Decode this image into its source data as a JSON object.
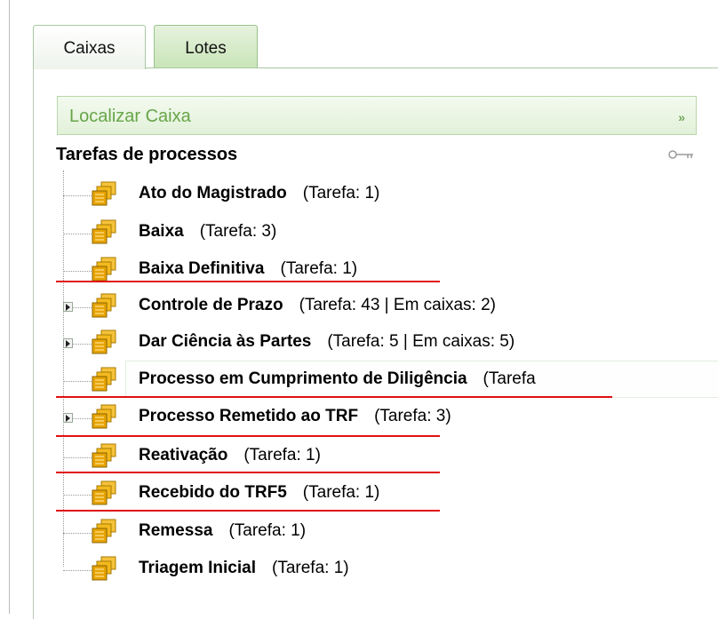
{
  "tabs": [
    {
      "label": "Caixas",
      "active": true
    },
    {
      "label": "Lotes",
      "active": false
    }
  ],
  "search": {
    "label": "Localizar Caixa",
    "arrow": "»"
  },
  "tree": {
    "title": "Tarefas de processos",
    "items": [
      {
        "name": "Ato do Magistrado",
        "count": "(Tarefa: 1)",
        "expandable": false,
        "selected": false
      },
      {
        "name": "Baixa",
        "count": "(Tarefa: 3)",
        "expandable": false,
        "selected": false
      },
      {
        "name": "Baixa Definitiva",
        "count": "(Tarefa: 1)",
        "expandable": false,
        "selected": false
      },
      {
        "name": "Controle de Prazo",
        "count": "(Tarefa: 43 | Em caixas: 2)",
        "expandable": true,
        "selected": false
      },
      {
        "name": "Dar Ciência às Partes",
        "count": "(Tarefa: 5 | Em caixas: 5)",
        "expandable": true,
        "selected": false
      },
      {
        "name": "Processo em Cumprimento de Diligência",
        "count": "(Tarefa",
        "expandable": false,
        "selected": true
      },
      {
        "name": "Processo Remetido ao TRF",
        "count": "(Tarefa: 3)",
        "expandable": true,
        "selected": false
      },
      {
        "name": "Reativação",
        "count": "(Tarefa: 1)",
        "expandable": false,
        "selected": false
      },
      {
        "name": "Recebido do TRF5",
        "count": "(Tarefa: 1)",
        "expandable": false,
        "selected": false
      },
      {
        "name": "Remessa",
        "count": "(Tarefa: 1)",
        "expandable": false,
        "selected": false
      },
      {
        "name": "Triagem Inicial",
        "count": "(Tarefa: 1)",
        "expandable": false,
        "selected": false
      }
    ]
  },
  "colors": {
    "accent_green": "#67a548",
    "annotation_red": "#e01010",
    "box_icon": "#d9a300"
  },
  "icons": {
    "box": "box-icon",
    "key": "key-icon",
    "expander": "expander-icon"
  }
}
